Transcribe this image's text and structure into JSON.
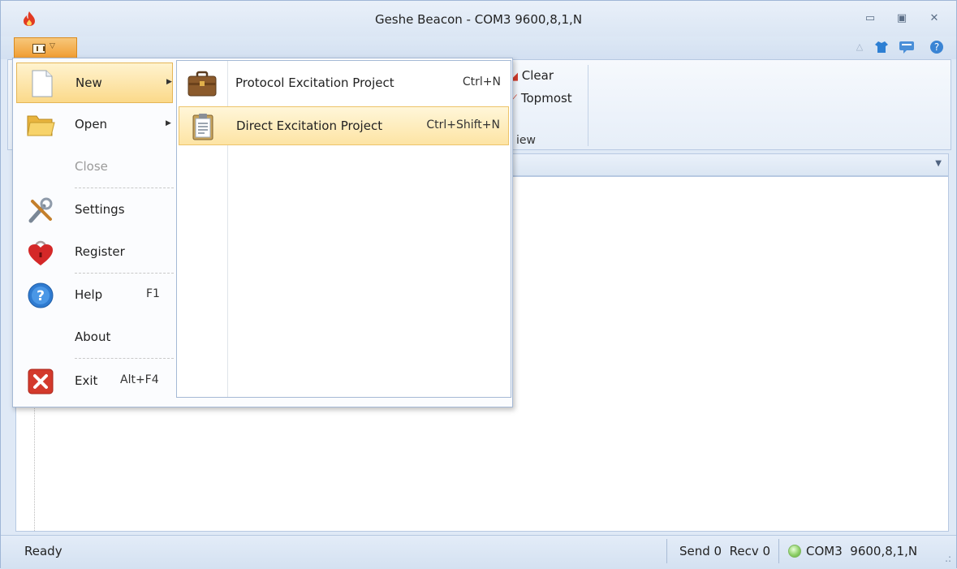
{
  "window": {
    "title": "Geshe Beacon - COM3  9600,8,1,N",
    "icon": "flame-icon",
    "controls": [
      "minimize-icon",
      "restore-icon",
      "close-icon"
    ]
  },
  "quick_access": [
    "warning-icon",
    "shirt-icon",
    "chat-icon",
    "help-icon"
  ],
  "ribbon": {
    "clear_label": "Clear",
    "topmost_label": "Topmost",
    "group_label": "iew"
  },
  "app_menu": {
    "items": [
      {
        "label": "New",
        "icon": "new-document-icon",
        "has_submenu": true,
        "highlighted": true
      },
      {
        "label": "Open",
        "icon": "open-folder-icon",
        "has_submenu": true
      },
      {
        "label": "Close",
        "icon": "",
        "disabled": true
      },
      {
        "label": "Settings",
        "icon": "tools-icon"
      },
      {
        "label": "Register",
        "icon": "heart-lock-icon"
      },
      {
        "label": "Help",
        "shortcut": "F1",
        "icon": "help-circle-icon"
      },
      {
        "label": "About",
        "icon": ""
      },
      {
        "label": "Exit",
        "shortcut": "Alt+F4",
        "icon": "exit-icon"
      }
    ],
    "submenu": [
      {
        "label": "Protocol Excitation Project",
        "shortcut": "Ctrl+N",
        "icon": "briefcase-icon"
      },
      {
        "label": "Direct Excitation Project",
        "shortcut": "Ctrl+Shift+N",
        "icon": "clipboard-icon",
        "highlighted": true
      }
    ]
  },
  "status": {
    "ready": "Ready",
    "counters": "Send 0  Recv 0",
    "port": "COM3  9600,8,1,N",
    "led_color": "#7cc95a"
  },
  "colors": {
    "accent_orange": "#f09a2c",
    "highlight": "#fbd98a",
    "chrome_blue": "#dfe9f6"
  }
}
